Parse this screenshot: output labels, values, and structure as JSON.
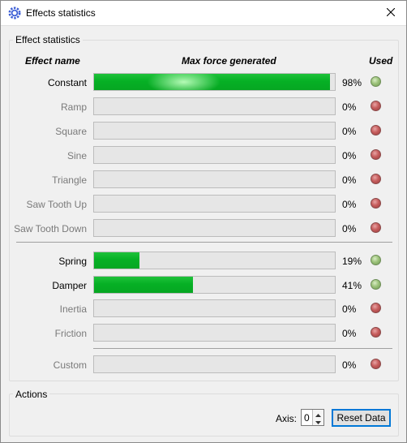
{
  "window": {
    "title": "Effects statistics"
  },
  "effect_stats": {
    "group_title": "Effect statistics",
    "headers": {
      "name": "Effect name",
      "force": "Max force generated",
      "used": "Used"
    },
    "rows": [
      {
        "name": "Constant",
        "value": 98,
        "percent": "98%",
        "used": true
      },
      {
        "name": "Ramp",
        "value": 0,
        "percent": "0%",
        "used": false
      },
      {
        "name": "Square",
        "value": 0,
        "percent": "0%",
        "used": false
      },
      {
        "name": "Sine",
        "value": 0,
        "percent": "0%",
        "used": false
      },
      {
        "name": "Triangle",
        "value": 0,
        "percent": "0%",
        "used": false
      },
      {
        "name": "Saw Tooth Up",
        "value": 0,
        "percent": "0%",
        "used": false
      },
      {
        "name": "Saw Tooth Down",
        "value": 0,
        "percent": "0%",
        "used": false
      },
      {
        "name": "Spring",
        "value": 19,
        "percent": "19%",
        "used": true
      },
      {
        "name": "Damper",
        "value": 41,
        "percent": "41%",
        "used": true
      },
      {
        "name": "Inertia",
        "value": 0,
        "percent": "0%",
        "used": false
      },
      {
        "name": "Friction",
        "value": 0,
        "percent": "0%",
        "used": false
      },
      {
        "name": "Custom",
        "value": 0,
        "percent": "0%",
        "used": false
      }
    ]
  },
  "actions": {
    "group_title": "Actions",
    "axis_label": "Axis:",
    "axis_value": "0",
    "reset_label": "Reset Data"
  },
  "colors": {
    "bar_fill": "#06b025",
    "led_used": "#9cc27a",
    "led_unused": "#c65d5d",
    "focus": "#0078d7"
  },
  "icons": {
    "app": "gear-icon",
    "close": "close-icon"
  }
}
